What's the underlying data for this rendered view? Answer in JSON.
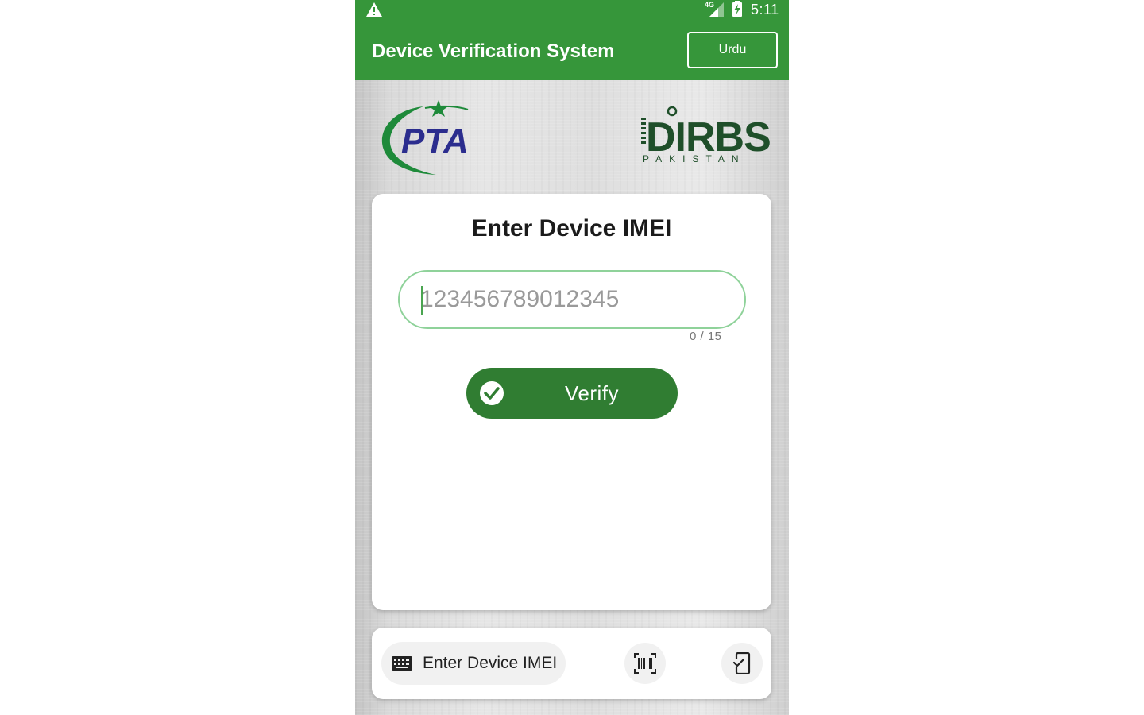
{
  "status_bar": {
    "network": "4G",
    "time": "5:11"
  },
  "app_bar": {
    "title": "Device Verification System",
    "language_button": "Urdu"
  },
  "logos": {
    "left": "PTA",
    "right": "DIRBS",
    "right_sub": "PAKISTAN"
  },
  "imei_card": {
    "heading": "Enter Device IMEI",
    "input_placeholder": "123456789012345",
    "input_value": "",
    "char_counter": "0 / 15",
    "verify_button": "Verify"
  },
  "bottom_nav": {
    "tabs": [
      {
        "label": "Enter Device IMEI",
        "icon": "keyboard-icon",
        "selected": true
      },
      {
        "label": "",
        "icon": "barcode-scan-icon",
        "selected": false
      },
      {
        "label": "",
        "icon": "device-check-icon",
        "selected": false
      }
    ]
  },
  "colors": {
    "app_bar": "#36963a",
    "verify_button": "#307d32",
    "input_border": "#8fd29a",
    "pta_green": "#1e8a3a",
    "pta_blue": "#2b2d8e",
    "dirbs_green": "#1f4f2a"
  }
}
